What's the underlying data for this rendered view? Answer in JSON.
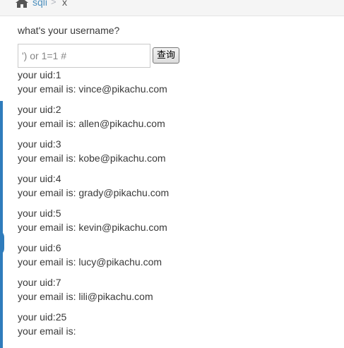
{
  "breadcrumb": {
    "link": "sqli",
    "separator": ">",
    "current": "x"
  },
  "form": {
    "question": "what's your username?",
    "input_value": "') or 1=1 #",
    "button_label": "查询"
  },
  "results": [
    {
      "uid": "your uid:1",
      "email": "your email is: vince@pikachu.com"
    },
    {
      "uid": "your uid:2",
      "email": "your email is: allen@pikachu.com"
    },
    {
      "uid": "your uid:3",
      "email": "your email is: kobe@pikachu.com"
    },
    {
      "uid": "your uid:4",
      "email": "your email is: grady@pikachu.com"
    },
    {
      "uid": "your uid:5",
      "email": "your email is: kevin@pikachu.com"
    },
    {
      "uid": "your uid:6",
      "email": "your email is: lucy@pikachu.com"
    },
    {
      "uid": "your uid:7",
      "email": "your email is: lili@pikachu.com"
    },
    {
      "uid": "your uid:25",
      "email": "your email is:"
    }
  ],
  "icons": {
    "home": "home-icon"
  },
  "colors": {
    "accent": "#2f7cbc",
    "link": "#4c8fbd",
    "text": "#393939"
  }
}
